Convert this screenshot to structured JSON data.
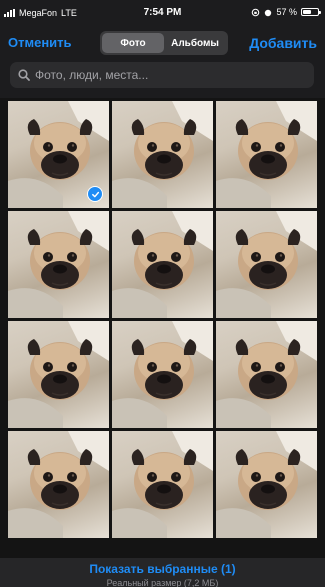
{
  "status_bar": {
    "carrier": "MegaFon",
    "network": "LTE",
    "time": "7:54 PM",
    "battery_percent": "57 %",
    "battery_level": 0.57
  },
  "nav": {
    "cancel_label": "Отменить",
    "segments": [
      {
        "label": "Фото",
        "selected": true
      },
      {
        "label": "Альбомы",
        "selected": false
      }
    ],
    "add_label": "Добавить"
  },
  "search": {
    "placeholder": "Фото, люди, места...",
    "icon": "search-icon"
  },
  "grid": {
    "rows": 4,
    "columns": 3,
    "selected_index": 0,
    "checkmark_icon": "checkmark-icon"
  },
  "bottom_bar": {
    "show_selected_label": "Показать выбранные (1)",
    "real_size_label": "Реальный размер (7,2 МБ)"
  },
  "colors": {
    "accent": "#1f8cf5",
    "background": "#1c1c1e"
  }
}
